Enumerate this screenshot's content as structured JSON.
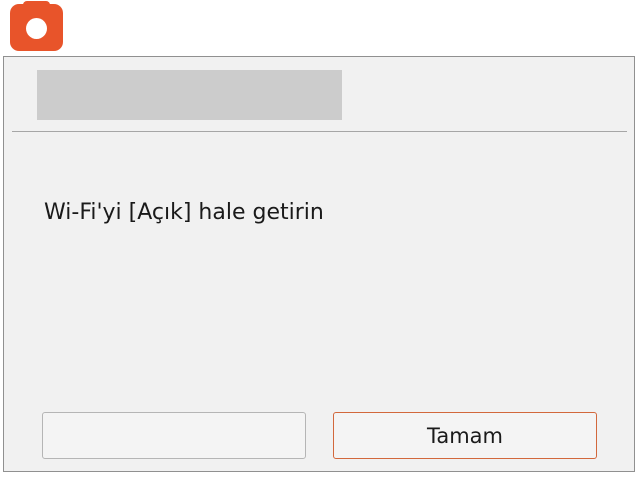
{
  "app": {
    "icon": "camera-icon",
    "accent_color": "#e8542a"
  },
  "dialog": {
    "title": "",
    "message": "Wi-Fi'yi [Açık] hale getirin"
  },
  "buttons": {
    "left_label": "",
    "ok_label": "Tamam",
    "ok_border_color": "#d2683c"
  }
}
